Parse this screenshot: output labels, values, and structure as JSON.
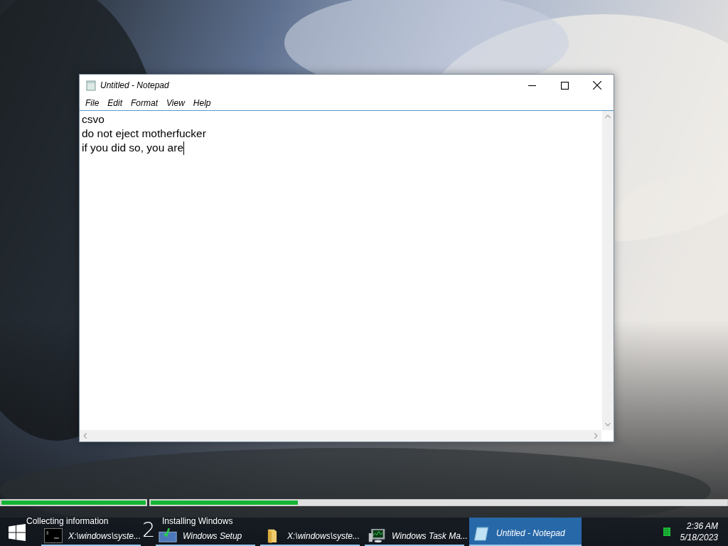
{
  "window": {
    "title": "Untitled - Notepad",
    "menu": [
      "File",
      "Edit",
      "Format",
      "View",
      "Help"
    ],
    "lines": [
      "csvo",
      "do not eject motherfucker",
      "if you did so, you are"
    ]
  },
  "setup_progress": [
    {
      "label": "Collecting information",
      "level": 1
    },
    {
      "label": "Installing Windows",
      "level": 0.255
    }
  ],
  "step_number": "2",
  "taskbar": {
    "items": [
      {
        "label": "X:\\windows\\syste...",
        "kind": "cmd",
        "selected": false
      },
      {
        "label": "Windows Setup",
        "kind": "setup",
        "selected": false
      },
      {
        "label": "X:\\windows\\syste...",
        "kind": "folder",
        "selected": false
      },
      {
        "label": "Windows Task Ma...",
        "kind": "taskmgr",
        "selected": false
      },
      {
        "label": "Untitled - Notepad",
        "kind": "notepad",
        "selected": true
      }
    ],
    "clock": {
      "time": "2:36 AM",
      "date": "5/18/2023"
    }
  }
}
